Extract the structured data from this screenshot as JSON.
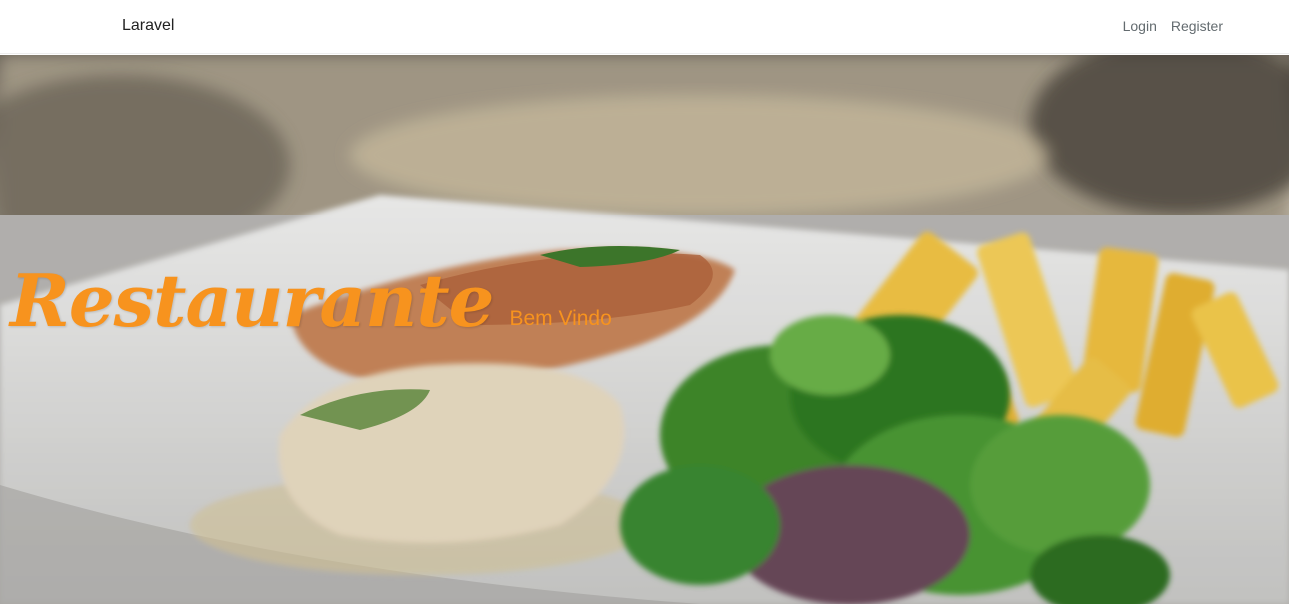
{
  "navbar": {
    "brand": "Laravel",
    "links": [
      "Login",
      "Register"
    ]
  },
  "hero": {
    "title": "Restaurante",
    "subtitle": "Bem Vindo",
    "accent_color": "#f7931e"
  }
}
